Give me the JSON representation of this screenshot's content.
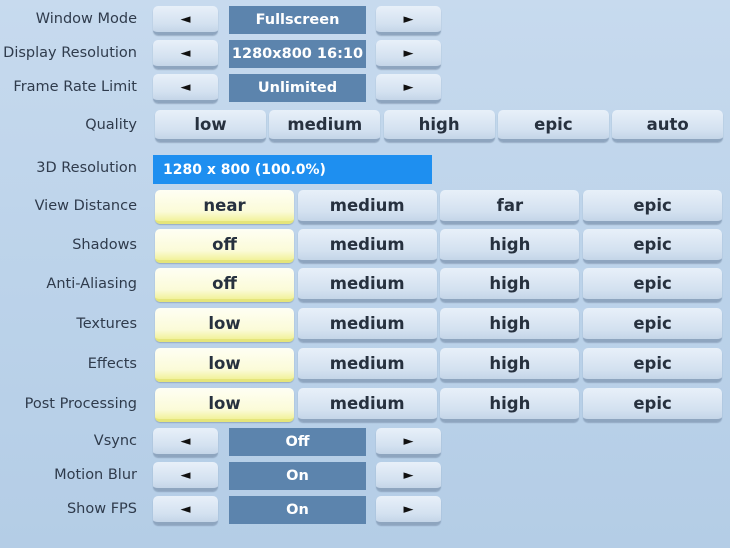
{
  "colors": {
    "value_box": "#5c84ad",
    "resolution_bar": "#1e8ff0",
    "selected": "#fbfbd8"
  },
  "arrow_rows": [
    {
      "label": "Window Mode",
      "value": "Fullscreen"
    },
    {
      "label": "Display Resolution",
      "value": "1280x800 16:10"
    },
    {
      "label": "Frame Rate Limit",
      "value": "Unlimited"
    }
  ],
  "arrows": {
    "left": "◄",
    "right": "►"
  },
  "quality": {
    "label": "Quality",
    "options": [
      "low",
      "medium",
      "high",
      "epic",
      "auto"
    ]
  },
  "resolution": {
    "label": "3D Resolution",
    "value": "1280 x 800 (100.0%)"
  },
  "option_rows": [
    {
      "label": "View Distance",
      "options": [
        "near",
        "medium",
        "far",
        "epic"
      ],
      "selected": 0
    },
    {
      "label": "Shadows",
      "options": [
        "off",
        "medium",
        "high",
        "epic"
      ],
      "selected": 0
    },
    {
      "label": "Anti-Aliasing",
      "options": [
        "off",
        "medium",
        "high",
        "epic"
      ],
      "selected": 0
    },
    {
      "label": "Textures",
      "options": [
        "low",
        "medium",
        "high",
        "epic"
      ],
      "selected": 0
    },
    {
      "label": "Effects",
      "options": [
        "low",
        "medium",
        "high",
        "epic"
      ],
      "selected": 0
    },
    {
      "label": "Post Processing",
      "options": [
        "low",
        "medium",
        "high",
        "epic"
      ],
      "selected": 0
    }
  ],
  "bottom_rows": [
    {
      "label": "Vsync",
      "value": "Off"
    },
    {
      "label": "Motion Blur",
      "value": "On"
    },
    {
      "label": "Show FPS",
      "value": "On"
    }
  ]
}
